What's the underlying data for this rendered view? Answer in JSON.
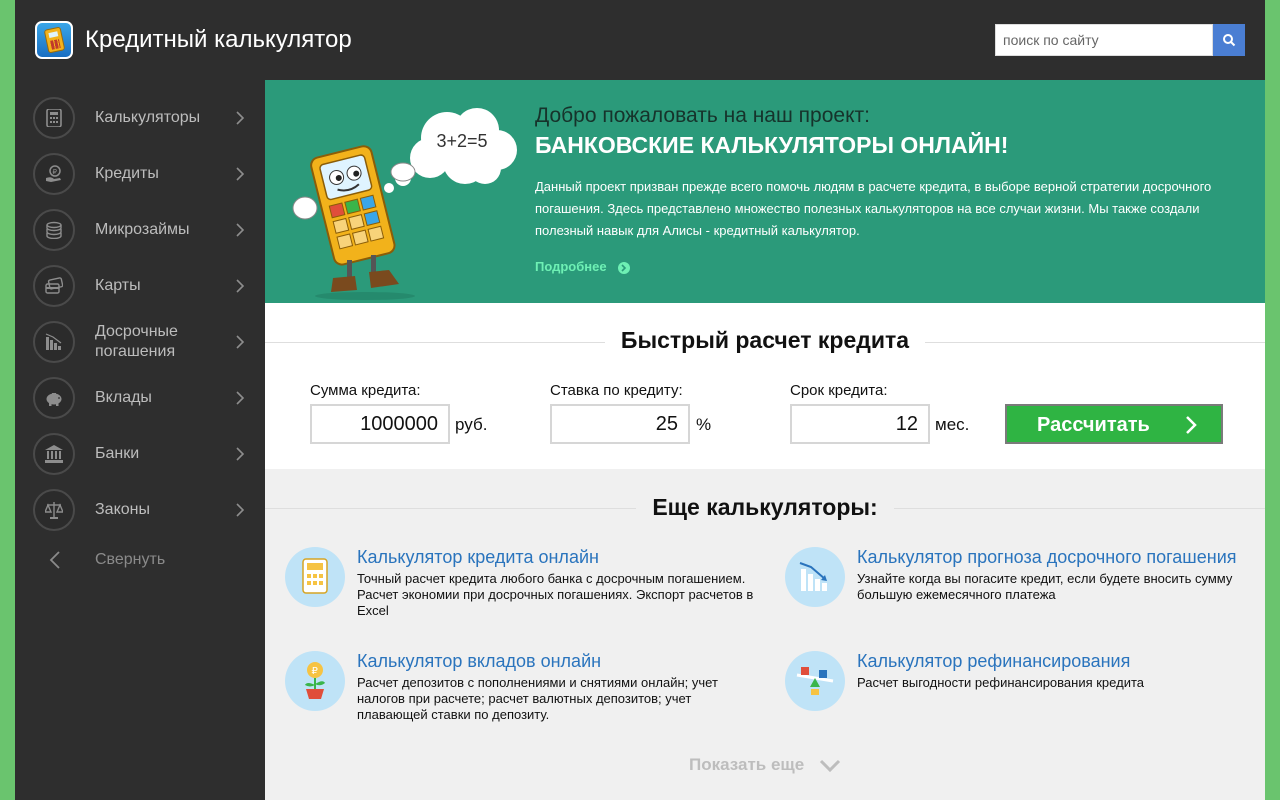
{
  "header": {
    "site_title": "Кредитный калькулятор",
    "search_placeholder": "поиск по сайту"
  },
  "sidebar": {
    "items": [
      {
        "label": "Калькуляторы",
        "icon": "calculator-icon"
      },
      {
        "label": "Кредиты",
        "icon": "ruble-hand-icon"
      },
      {
        "label": "Микрозаймы",
        "icon": "coins-icon"
      },
      {
        "label": "Карты",
        "icon": "cards-icon"
      },
      {
        "label": "Досрочные погашения",
        "icon": "chart-down-icon"
      },
      {
        "label": "Вклады",
        "icon": "piggy-bank-icon"
      },
      {
        "label": "Банки",
        "icon": "bank-icon"
      },
      {
        "label": "Законы",
        "icon": "scales-icon"
      }
    ],
    "collapse_label": "Свернуть"
  },
  "hero": {
    "thought_bubble": "3+2=5",
    "subtitle": "Добро пожаловать на наш проект:",
    "title": "БАНКОВСКИЕ КАЛЬКУЛЯТОРЫ ОНЛАЙН!",
    "text": "Данный проект призван прежде всего помочь людям в расчете кредита, в выборе верной стратегии досрочного погашения. Здесь представлено множество полезных калькуляторов на все случаи жизни. Мы также создали полезный навык для Алисы - кредитный калькулятор.",
    "more_link": "Подробнее"
  },
  "quick_calc": {
    "title": "Быстрый расчет кредита",
    "amount": {
      "label": "Сумма кредита:",
      "value": "1000000",
      "unit": "руб."
    },
    "rate": {
      "label": "Ставка по кредиту:",
      "value": "25",
      "unit": "%"
    },
    "term": {
      "label": "Срок кредита:",
      "value": "12",
      "unit": "мес."
    },
    "button": "Рассчитать"
  },
  "more_calcs": {
    "title": "Еще калькуляторы:",
    "cards": [
      {
        "title": "Калькулятор кредита онлайн",
        "desc": "Точный расчет кредита любого банка с досрочным погашением. Расчет экономии при досрочных погашениях. Экспорт расчетов в Excel",
        "icon": "calculator-icon"
      },
      {
        "title": "Калькулятор прогноза досрочного погашения",
        "desc": "Узнайте когда вы погасите кредит, если будете вносить сумму большую ежемесячного платежа",
        "icon": "chart-down-icon"
      },
      {
        "title": "Калькулятор вкладов онлайн",
        "desc": "Расчет депозитов с пополнениями и снятиями онлайн; учет налогов при расчете; расчет валютных депозитов; учет плавающей ставки по депозиту.",
        "icon": "money-plant-icon"
      },
      {
        "title": "Калькулятор рефинансирования",
        "desc": "Расчет выгодности рефинансирования кредита",
        "icon": "balance-seesaw-icon"
      }
    ],
    "show_more": "Показать еще"
  },
  "colors": {
    "outer_background": "#6ac46e",
    "header_background": "#2e2e2e",
    "hero_background": "#2b9a7a",
    "button_green": "#2fb443",
    "link_blue": "#2a74bd"
  }
}
